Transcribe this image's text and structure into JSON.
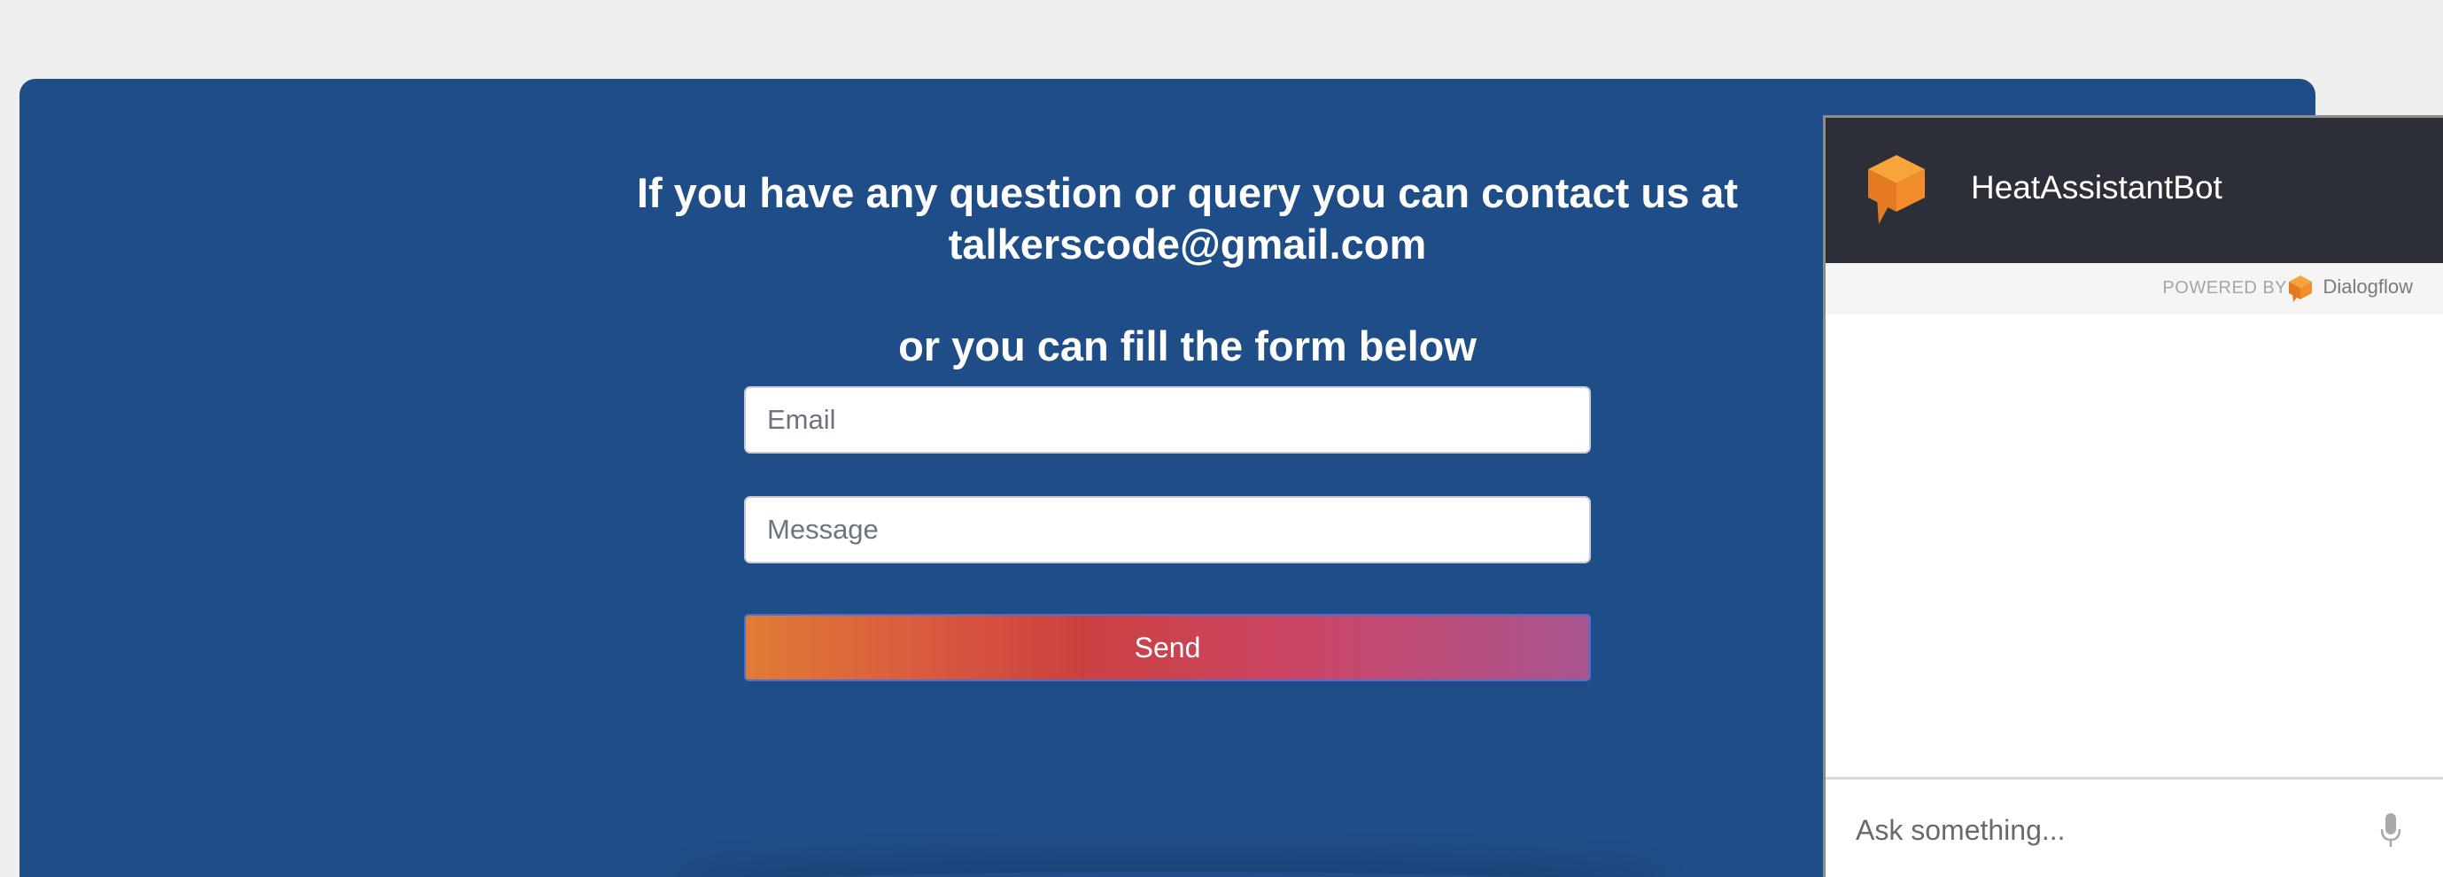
{
  "contact": {
    "headline_line1": "If you have any question or query you can contact us at",
    "headline_line2": "talkerscode@gmail.com",
    "subline": "or you can fill the form below",
    "email_placeholder": "Email",
    "message_placeholder": "Message",
    "send_label": "Send",
    "panel_color": "#1f4d87"
  },
  "chat": {
    "bot_name": "HeatAssistantBot",
    "bot_icon": "speech-cube-logo-icon",
    "powered_by": "POWERED BY",
    "brand_name": "Dialogflow",
    "brand_icon": "dialogflow-logo-icon",
    "input_placeholder": "Ask something...",
    "mic_icon": "microphone-icon",
    "header_color": "#2d2f38",
    "accent_color": "#f0892b"
  }
}
